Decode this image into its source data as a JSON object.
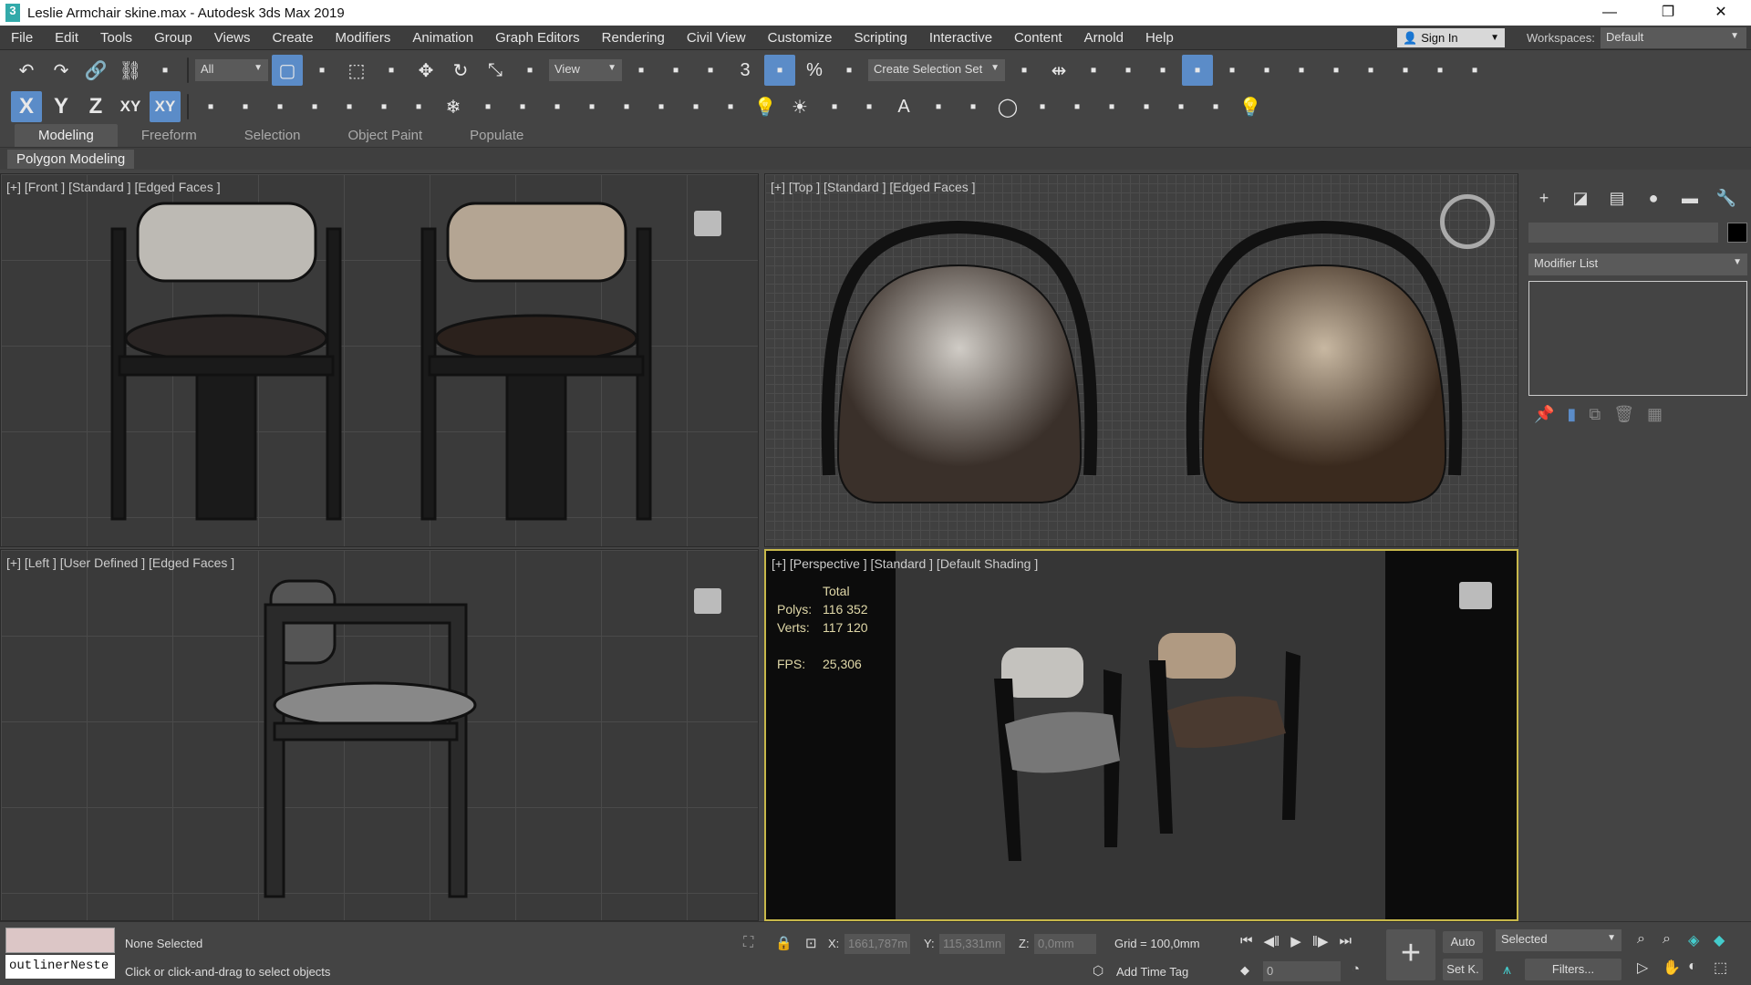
{
  "window": {
    "title": "Leslie Armchair skine.max - Autodesk 3ds Max 2019",
    "app_icon": "3",
    "minimize": "—",
    "restore": "❐",
    "close": "✕"
  },
  "menu": [
    "File",
    "Edit",
    "Tools",
    "Group",
    "Views",
    "Create",
    "Modifiers",
    "Animation",
    "Graph Editors",
    "Rendering",
    "Civil View",
    "Customize",
    "Scripting",
    "Interactive",
    "Content",
    "Arnold",
    "Help"
  ],
  "account": {
    "sign_in": "Sign In",
    "workspaces_label": "Workspaces:",
    "workspace": "Default"
  },
  "toolbar1": {
    "filter": "All",
    "ref_coord": "View",
    "selection_set": "Create Selection Set",
    "icons": [
      "undo-icon",
      "redo-icon",
      "link-icon",
      "unlink-icon",
      "bind-space-warp-icon"
    ],
    "icons2": [
      "select-object-icon",
      "select-by-name-icon",
      "rectangle-selection-icon",
      "window-crossing-icon",
      "move-icon",
      "rotate-icon",
      "scale-icon",
      "placement-icon"
    ],
    "icons3": [
      "use-pivot-icon",
      "select-manipulate-icon",
      "keyboard-shortcut-icon",
      "snap-3d-icon",
      "angle-snap-icon",
      "percent-snap-icon",
      "spinner-snap-icon"
    ],
    "icons4": [
      "edit-named-selection-icon",
      "mirror-icon",
      "align-icon",
      "scene-explorer-icon",
      "layer-explorer-icon",
      "ribbon-toggle-icon",
      "curve-editor-icon",
      "schematic-view-icon",
      "material-editor-icon",
      "render-setup-icon",
      "rendered-frame-icon",
      "render-production-icon",
      "render-iterative-icon",
      "render-cloud-icon"
    ]
  },
  "toolbar2": {
    "axes": [
      "X",
      "Y",
      "Z",
      "XY",
      "XY"
    ],
    "icons": [
      "snap-grid-icon",
      "snap-pivot-icon",
      "snap-vertex-icon",
      "snap-edge-icon",
      "snap-midpoint-icon",
      "snap-face-icon",
      "snap-normal-icon",
      "freeze-icon",
      "bbox-icon",
      "grid-points-icon",
      "pivot-icon",
      "vase-icon",
      "sphere-icon",
      "pin-icon",
      "curve-icon",
      "snap-axis-icon",
      "light-icon",
      "sun-icon",
      "camera-icon",
      "terrain-icon",
      "text-icon",
      "shape-icon",
      "loft-icon",
      "torus-icon",
      "sphere-map-icon",
      "viewport-icon",
      "film-icon",
      "particles-icon",
      "box-icon",
      "teapot-icon",
      "bulb-icon"
    ]
  },
  "ribbon": {
    "tabs": [
      "Modeling",
      "Freeform",
      "Selection",
      "Object Paint",
      "Populate"
    ],
    "active": "Modeling",
    "sub": "Polygon Modeling"
  },
  "viewports": {
    "front": "[+] [Front ] [Standard ] [Edged Faces ]",
    "top": "[+] [Top ] [Standard ] [Edged Faces ]",
    "left": "[+] [Left ] [User Defined ] [Edged Faces ]",
    "perspective": "[+] [Perspective ] [Standard ] [Default Shading ]",
    "stats": {
      "total": "Total",
      "polys_label": "Polys:",
      "polys": "116 352",
      "verts_label": "Verts:",
      "verts": "117 120",
      "fps_label": "FPS:",
      "fps": "25,306"
    }
  },
  "command_panel": {
    "tabs": [
      "create-icon",
      "modify-icon",
      "hierarchy-icon",
      "motion-icon",
      "display-icon",
      "utilities-icon"
    ],
    "tab_glyphs": [
      "+",
      "◪",
      "▤",
      "●",
      "▬",
      "🔧"
    ],
    "modifier_list": "Modifier List",
    "name_value": ""
  },
  "status": {
    "outliner": "outlinerNeste",
    "selection": "None Selected",
    "prompt": "Click or click-and-drag to select objects",
    "x_label": "X:",
    "x": "1661,787m",
    "y_label": "Y:",
    "y": "115,331mn",
    "z_label": "Z:",
    "z": "0,0mm",
    "grid": "Grid = 100,0mm",
    "add_time_tag": "Add Time Tag",
    "frame": "0",
    "auto": "Auto",
    "set_key": "Set K.",
    "key_filter": "Selected",
    "filters": "Filters..."
  },
  "colors": {
    "accent": "#5b8cc8",
    "active_viewport": "#c8b84a"
  }
}
